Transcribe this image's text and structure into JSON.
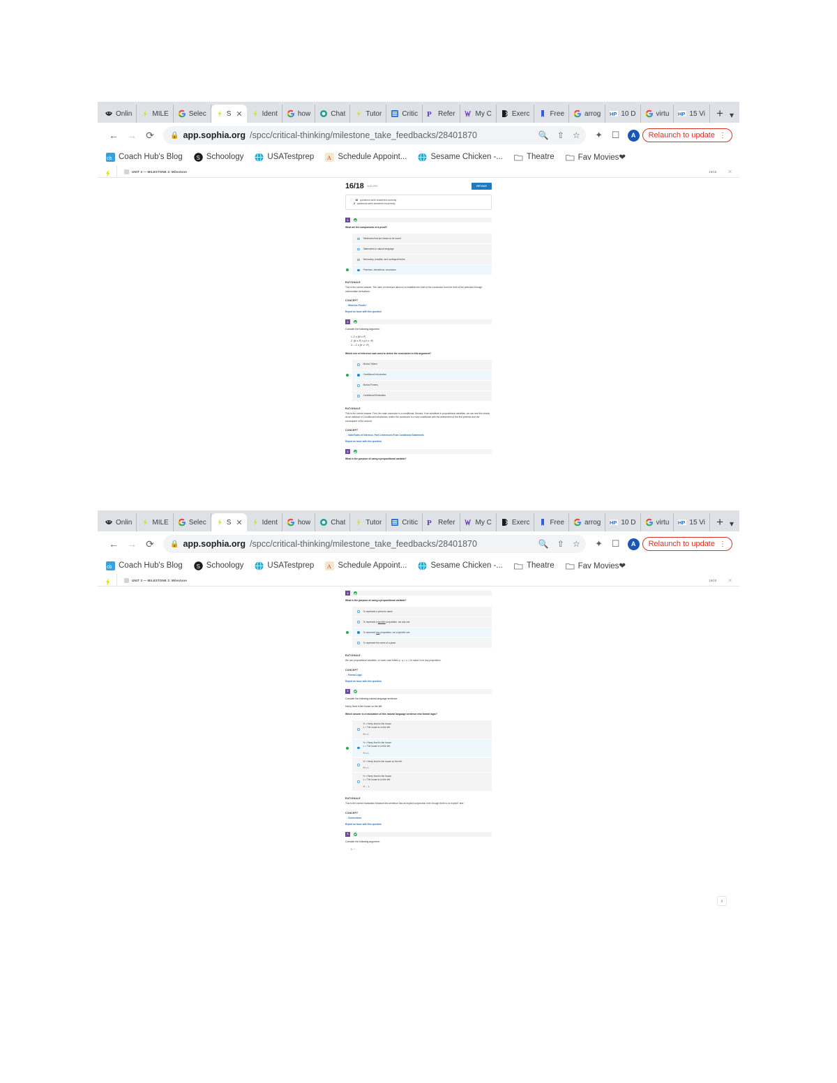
{
  "browser": {
    "tabs": [
      {
        "favicon": "wolverine-icon",
        "label": "Onlin",
        "active": false
      },
      {
        "favicon": "sophia-icon",
        "label": "MILE",
        "active": false
      },
      {
        "favicon": "google-icon",
        "label": "Selec",
        "active": false
      },
      {
        "favicon": "sophia-icon",
        "label": "S",
        "active": true
      },
      {
        "favicon": "sophia-icon",
        "label": "Ident",
        "active": false
      },
      {
        "favicon": "google-icon",
        "label": "how ",
        "active": false
      },
      {
        "favicon": "chat-icon",
        "label": "Chat",
        "active": false
      },
      {
        "favicon": "sophia-icon",
        "label": "Tutor",
        "active": false
      },
      {
        "favicon": "doc-icon",
        "label": "Critic",
        "active": false
      },
      {
        "favicon": "pearson-icon",
        "label": "Refer",
        "active": false
      },
      {
        "favicon": "vw-icon",
        "label": "My C",
        "active": false
      },
      {
        "favicon": "bracket-icon",
        "label": "Exerc",
        "active": false
      },
      {
        "favicon": "bookmark-icon",
        "label": "Free",
        "active": false
      },
      {
        "favicon": "google-icon",
        "label": "arrog",
        "active": false
      },
      {
        "favicon": "hp-icon",
        "label": "10 D",
        "active": false
      },
      {
        "favicon": "google-icon",
        "label": "virtu",
        "active": false
      },
      {
        "favicon": "hp-icon",
        "label": "15 Vi",
        "active": false
      }
    ],
    "new_tab_label": "+",
    "toolbar": {
      "back_label": "←",
      "forward_label": "→",
      "reload_label": "⟳",
      "lock_label": "🔒",
      "url_domain": "app.sophia.org",
      "url_path": "/spcc/critical-thinking/milestone_take_feedbacks/28401870",
      "search_icon": "search-icon",
      "share_icon": "share-icon",
      "bookmark_icon": "star-icon",
      "extensions_icon": "puzzle-icon",
      "sidepanel_icon": "side-panel-icon",
      "avatar_initial": "A",
      "relaunch_label": "Relaunch to update",
      "kebab_label": "⋮"
    },
    "bookmarks": [
      {
        "icon": "coachhub-icon",
        "label": "Coach Hub's Blog"
      },
      {
        "icon": "schoology-icon",
        "label": "Schoology"
      },
      {
        "icon": "globe-icon",
        "label": "USATestprep"
      },
      {
        "icon": "appointment-icon",
        "label": "Schedule Appoint..."
      },
      {
        "icon": "globe-icon",
        "label": "Sesame Chicken -..."
      },
      {
        "icon": "folder-icon",
        "label": "Theatre"
      },
      {
        "icon": "folder-icon",
        "label": "Fav Movies❤"
      }
    ]
  },
  "appbar": {
    "logo": "sophia-logo-icon",
    "breadcrumb_icon": "milestone-icon",
    "breadcrumb": "UNIT 3 — MILESTONE 3: Milestone",
    "score": "16/18",
    "close_label": "✕"
  },
  "results": {
    "score": "16/18",
    "score_sub": "that's 89%",
    "retake_label": "RETAKE",
    "summary_icon": "info-icon",
    "correct_count": "16",
    "correct_text": "questions were answered correctly",
    "incorrect_count": "2",
    "incorrect_text": "questions were answered incorrectly"
  },
  "labels": {
    "rationale": "RATIONALE",
    "concept": "CONCEPT",
    "report": "Report an issue with this question",
    "concept_arrow": "→ "
  },
  "questions": [
    {
      "number": "1",
      "status": "correct",
      "prompt": "What are the components of a proof?",
      "options": [
        {
          "text": "Sentences that are shown to be sound",
          "correct": false
        },
        {
          "text": "Statements in natural language",
          "correct": false
        },
        {
          "text": "Necessary, possible, and contingent truths",
          "correct": false
        },
        {
          "text": "Premises, derivations, conclusion",
          "correct": true
        }
      ],
      "rationale": "This is the correct answer. The rules of inference allow us to establish the truth of the conclusion from the truth of the premises through intermediate derivations.",
      "concept": "What Are Proofs?"
    },
    {
      "number": "2",
      "status": "correct",
      "intro": "Consider the following argument:",
      "argument": [
        "1.  Z ∨ (M ∧ P)",
        "2. (M ∧ P) ∨ (H ∨ ¬P)",
        "3.  ∴ Z ∨ (H ∨ ¬P)"
      ],
      "prompt": "Which rule of inference was used to derive the conclusion in this argument?",
      "options": [
        {
          "text": "Modus Tollens",
          "correct": false
        },
        {
          "text": "Conditional Introduction",
          "correct": true
        },
        {
          "text": "Modus Ponens",
          "correct": false
        },
        {
          "text": "Conditional Elimination",
          "correct": false
        }
      ],
      "rationale": "This is the correct answer. First, the main connector is a conditional. Second, if we substitute in propositional variables, we can see this clearly as an instance of Conditional Introduction, where the conclusion is a new conditional with the antecedent of the first premise and the consequent of the second.",
      "concept": "Valid Rules of Inference, Part 1 Inferences From Conditional Statements"
    },
    {
      "number": "3",
      "status": "correct",
      "prompt": "What is the purpose of using a propositional variable?",
      "options": [
        {
          "text": "To represent a person's name",
          "correct": false
        },
        {
          "text": "To represent a specific proposition, not any one",
          "correct": false,
          "underline": "specific"
        },
        {
          "text": "To represent any proposition, not a specific one",
          "correct": true,
          "underline": "any"
        },
        {
          "text": "To represent the name of a place",
          "correct": false
        }
      ],
      "rationale": "We use propositional variables, or lower case letters p, q, r, s, t, to stand in for any proposition.",
      "concept": "Formal Logic"
    },
    {
      "number": "4",
      "status": "correct",
      "intro": "Consider the following natural language sentence:",
      "sentence": "Henry lived in the house on the left.",
      "prompt": "Which answer is a translation of this natural language sentence into formal logic?",
      "options": [
        {
          "lines": [
            "H = Henry lived in the house.",
            "L = The house is on the left.",
            "",
            "H ∨ L"
          ],
          "correct": false
        },
        {
          "lines": [
            "H = Henry lived in the house.",
            "L = The house is on the left.",
            "",
            "H ∧ L"
          ],
          "correct": true
        },
        {
          "lines": [
            "H = Henry lived in the house on the left.",
            "",
            "H ∧ L"
          ],
          "correct": false
        },
        {
          "lines": [
            "H = Henry lived in the house.",
            "L = The house is on the left.",
            "",
            "H → L"
          ],
          "correct": false
        }
      ],
      "rationale": "This is the correct translation because this sentence has an implicit conjunction even though there is no explicit \"and.\"",
      "concept": "Connectives"
    },
    {
      "number": "5",
      "status": "correct",
      "intro": "Consider the following argument:",
      "argument": [
        "1. ~"
      ]
    }
  ],
  "scrolltop_label": "∧"
}
